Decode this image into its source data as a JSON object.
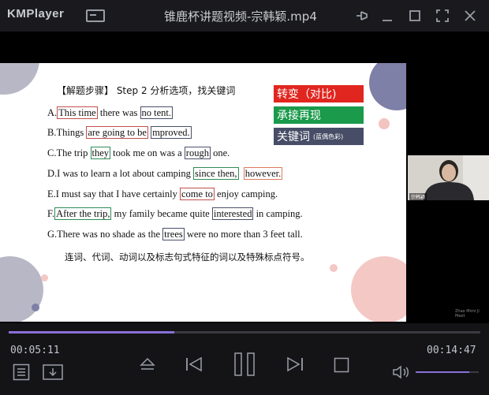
{
  "app": {
    "name": "KMPlayer",
    "file_title": "锥鹿杯讲题视频-宗韩颖.mp4"
  },
  "slide": {
    "heading": "【解题步骤】 Step 2 分析选项，找关键词",
    "lines": [
      {
        "id": "a",
        "segments": [
          {
            "t": "A."
          },
          {
            "t": "This time",
            "box": "r"
          },
          {
            "t": " there was "
          },
          {
            "t": "no tent.",
            "box": "b"
          }
        ]
      },
      {
        "id": "b",
        "segments": [
          {
            "t": "B.Things "
          },
          {
            "t": "are going to be",
            "box": "r"
          },
          {
            "t": " "
          },
          {
            "t": "mproved.",
            "box": "b"
          }
        ]
      },
      {
        "id": "c",
        "segments": [
          {
            "t": "C.The trip "
          },
          {
            "t": "they",
            "box": "g"
          },
          {
            "t": " took me on was a "
          },
          {
            "t": "rough",
            "box": "b"
          },
          {
            "t": " one."
          }
        ]
      },
      {
        "id": "d",
        "segments": [
          {
            "t": "D.I was to learn a lot about camping "
          },
          {
            "t": "since then,",
            "box": "g"
          },
          {
            "t": "  "
          },
          {
            "t": "however.",
            "box": "o"
          }
        ]
      },
      {
        "id": "e",
        "segments": [
          {
            "t": "E.I must say that I have certainly "
          },
          {
            "t": "come to",
            "box": "r"
          },
          {
            "t": " enjoy camping."
          }
        ]
      },
      {
        "id": "f",
        "segments": [
          {
            "t": "F."
          },
          {
            "t": "After the trip,",
            "box": "g"
          },
          {
            "t": " my family became quite "
          },
          {
            "t": "interested",
            "box": "b"
          },
          {
            "t": " in camping."
          }
        ]
      },
      {
        "id": "g",
        "segments": [
          {
            "t": "G.There was no shade as the "
          },
          {
            "t": "trees",
            "box": "b"
          },
          {
            "t": " were no more than 3 feet tall."
          }
        ]
      }
    ],
    "legend": [
      {
        "label": "转变（对比)",
        "note": "",
        "color": "#e0261f"
      },
      {
        "label": "承接再现",
        "note": "",
        "color": "#1a9a4a"
      },
      {
        "label": "关键词",
        "note": "(蓝偶色彩)",
        "color": "#474d66"
      }
    ],
    "summary": "连词、代词、动词以及标志句式特征的词以及特殊标点符号。"
  },
  "webcam": {
    "label": "宗韩颖"
  },
  "watermark": "Zhao Mimi Ji Meet",
  "playback": {
    "current_time": "00:05:11",
    "total_time": "00:14:47",
    "progress": 0.351,
    "volume": 0.85
  }
}
